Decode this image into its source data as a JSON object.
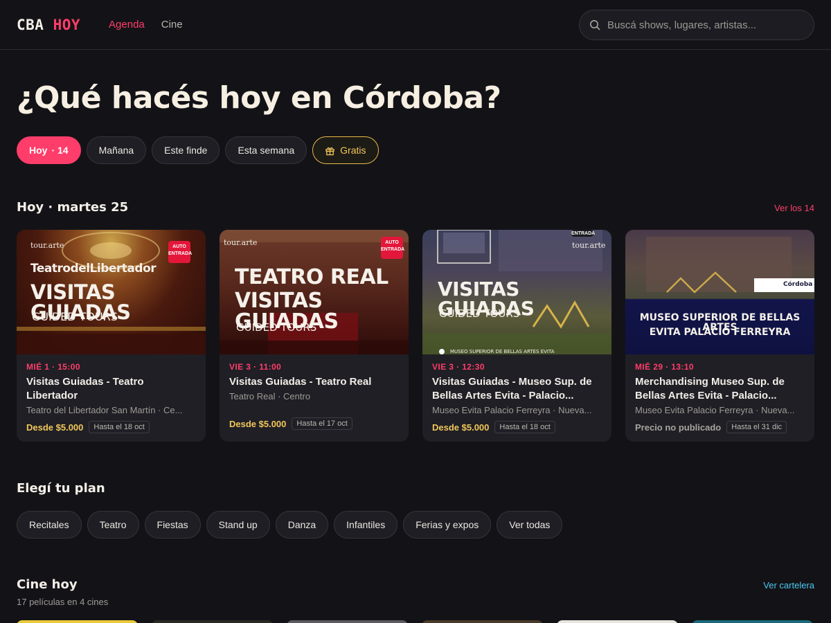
{
  "header": {
    "logo_a": "CBA",
    "logo_b": "HOY",
    "nav": [
      {
        "label": "Agenda",
        "active": true
      },
      {
        "label": "Cine",
        "active": false
      }
    ],
    "search_placeholder": "Buscá shows, lugares, artistas..."
  },
  "hero": {
    "title": "¿Qué hacés hoy en Córdoba?",
    "filters": {
      "hoy": "Hoy",
      "hoy_count": "· 14",
      "manana": "Mañana",
      "finde": "Este finde",
      "semana": "Esta semana",
      "gratis": "Gratis"
    }
  },
  "today": {
    "title": "Hoy · martes 25",
    "link": "Ver los 14",
    "cards": [
      {
        "img_brand": "tour.arte",
        "img_badge_1": "AUTO",
        "img_badge_2": "ENTRADA",
        "img_line1": "TeatrodelLibertador",
        "img_line2": "VISITAS GUIADAS",
        "img_line3": "GUIDED TOURS",
        "date": "MIÉ 1 · 15:00",
        "title": "Visitas Guiadas - Teatro Libertador",
        "place": "Teatro del Libertador San Martín · Ce...",
        "price": "Desde $5.000",
        "until": "Hasta el 18 oct"
      },
      {
        "img_brand": "tour.arte",
        "img_badge_1": "AUTO",
        "img_badge_2": "ENTRADA",
        "img_line1": "TEATRO REAL",
        "img_line2": "VISITAS GUIADAS",
        "img_line3": "GUIDED TOURS",
        "date": "VIE 3 · 11:00",
        "title": "Visitas Guiadas - Teatro Real",
        "place": "Teatro Real · Centro",
        "price": "Desde $5.000",
        "until": "Hasta el 17 oct"
      },
      {
        "img_brand": "tour.arte",
        "img_badge": "ENTRADA",
        "img_line1": "VISITAS GUIADAS",
        "img_line2": "GUIDED TOURS",
        "img_footer": "MUSEO SUPERIOR DE BELLAS ARTES EVITA",
        "date": "VIE 3 · 12:30",
        "title": "Visitas Guiadas - Museo Sup. de Bellas Artes Evita - Palacio...",
        "place": "Museo Evita Palacio Ferreyra · Nueva...",
        "price": "Desde $5.000",
        "until": "Hasta el 18 oct"
      },
      {
        "img_line1": "MUSEO SUPERIOR DE BELLAS ARTES",
        "img_line2": "EVITA PALACIO FERREYRA",
        "img_logo": "Córdoba",
        "date": "MIÉ 29 · 13:10",
        "title": "Merchandising Museo Sup. de Bellas Artes Evita - Palacio...",
        "place": "Museo Evita Palacio Ferreyra · Nueva...",
        "price": "Precio no publicado",
        "until": "Hasta el 31 dic"
      }
    ]
  },
  "plans": {
    "title": "Elegí tu plan",
    "items": [
      "Recitales",
      "Teatro",
      "Fiestas",
      "Stand up",
      "Danza",
      "Infantiles",
      "Ferias y expos",
      "Ver todas"
    ]
  },
  "cine": {
    "title": "Cine hoy",
    "subtitle": "17 películas en 4 cines",
    "link": "Ver cartelera"
  },
  "colors": {
    "background": "#131317",
    "accent": "#ff3d6a",
    "price": "#f2c75a",
    "link_cine": "#4cc9f0"
  }
}
